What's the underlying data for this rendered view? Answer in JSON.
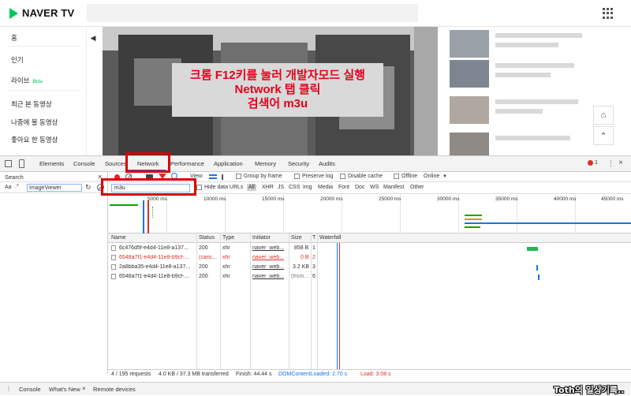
{
  "naver": {
    "logo_text": "NAVER TV",
    "sidebar": {
      "home": "홈",
      "popular": "인기",
      "live": "라이브",
      "live_badge": "Beta",
      "recent": "최근 본 동영상",
      "later": "나중에 볼 동영상",
      "liked": "좋아요 한 동영상"
    },
    "overlay": {
      "line1": "크롬 F12키를 눌러 개발자모드 실행",
      "line2": "Network 탭 클릭",
      "line3": "검색어 m3u"
    }
  },
  "devtools": {
    "tabs": [
      "Elements",
      "Console",
      "Sources",
      "Network",
      "Performance",
      "Application",
      "Memory",
      "Security",
      "Audits"
    ],
    "active_tab": "Network",
    "error_count": "1",
    "search_panel": {
      "title": "Search",
      "query": "ImageViewer",
      "case_label": "Aa",
      "regex_label": ".*"
    },
    "toolbar": {
      "view_label": "View:",
      "group_by_frame": "Group by frame",
      "preserve_log": "Preserve log",
      "disable_cache": "Disable cache",
      "offline": "Offline",
      "throttle": "Online"
    },
    "filter": {
      "value": "m3u",
      "hide_data_urls": "Hide data URLs",
      "types": [
        "All",
        "XHR",
        "JS",
        "CSS",
        "Img",
        "Media",
        "Font",
        "Doc",
        "WS",
        "Manifest",
        "Other"
      ]
    },
    "overview_ticks": [
      "5000 ms",
      "10000 ms",
      "15000 ms",
      "20000 ms",
      "25000 ms",
      "30000 ms",
      "35000 ms",
      "40000 ms",
      "45000 ms"
    ],
    "table": {
      "headers": [
        "Name",
        "Status",
        "Type",
        "Initiator",
        "Size",
        "T",
        "Waterfall"
      ],
      "rows": [
        {
          "name": "6c476d5f-e4d4-11e8-a137...",
          "status": "200",
          "type": "xhr",
          "initiator": "naver_web...",
          "size": "858 B",
          "time": "1",
          "error": false
        },
        {
          "name": "6548a7f1-e4d4-11e8-b9cf-...",
          "status": "(canc...",
          "type": "xhr",
          "initiator": "naver_web...",
          "size": "0 B",
          "time": "2",
          "error": true
        },
        {
          "name": "2a8bba35-e4d4-11e8-a137...",
          "status": "200",
          "type": "xhr",
          "initiator": "naver_web...",
          "size": "3.2 KB",
          "time": "3",
          "error": false
        },
        {
          "name": "6548a7f1-e4d4-11e8-b9cf-...",
          "status": "200",
          "type": "xhr",
          "initiator": "naver_web...",
          "size": "(from...",
          "time": "6",
          "error": false
        }
      ]
    },
    "status_bar": {
      "requests": "4 / 195 requests",
      "transferred": "4.0 KB / 37.3 MB transferred",
      "finish": "Finish: 44.44 s",
      "dcl": "DOMContentLoaded: 2.70 s",
      "load": "Load: 3.08 s"
    },
    "drawer": {
      "tabs": [
        "Console",
        "What's New",
        "Remote devices"
      ],
      "watermark": "Toth의 일상기록.."
    }
  }
}
